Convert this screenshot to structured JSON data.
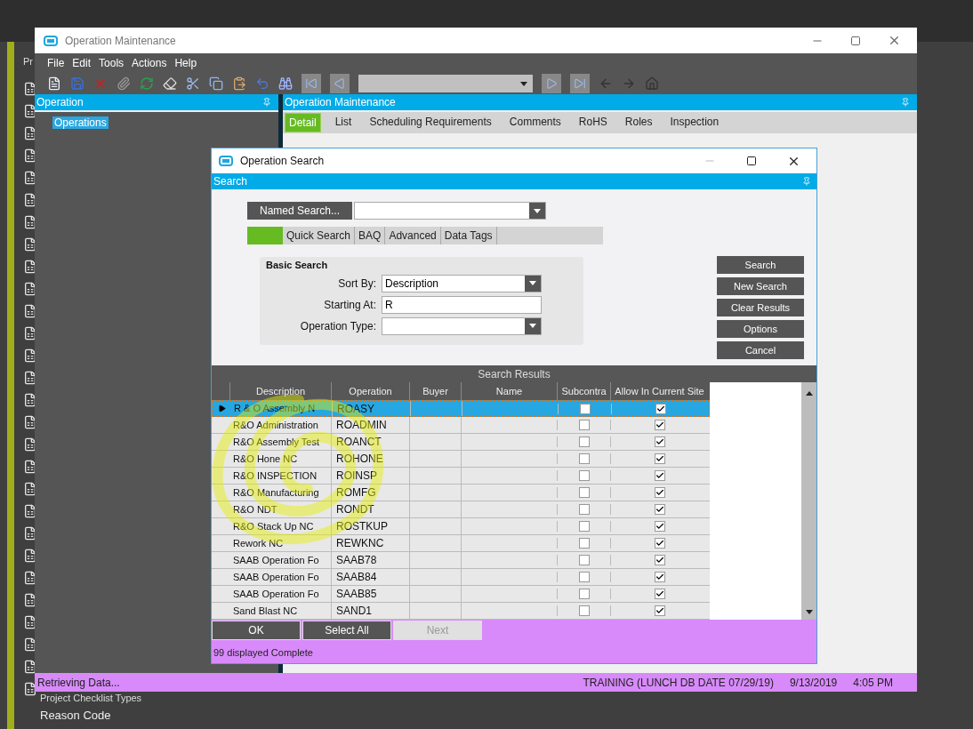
{
  "background": {
    "top_item": "Pr",
    "items": [
      "Project Checklist Types",
      "Reason Code"
    ]
  },
  "window": {
    "title": "Operation Maintenance",
    "menu": [
      "File",
      "Edit",
      "Tools",
      "Actions",
      "Help"
    ]
  },
  "left_pane": {
    "title": "Operation",
    "tree": [
      {
        "label": "Operations",
        "selected": true
      }
    ]
  },
  "right_pane": {
    "title": "Operation Maintenance",
    "tabs": [
      {
        "label": "Detail",
        "selected": true
      },
      {
        "label": "List",
        "selected": false
      },
      {
        "label": "Scheduling Requirements",
        "selected": false
      },
      {
        "label": "Comments",
        "selected": false
      },
      {
        "label": "RoHS",
        "selected": false
      },
      {
        "label": "Roles",
        "selected": false
      },
      {
        "label": "Inspection",
        "selected": false
      }
    ]
  },
  "dialog": {
    "title": "Operation Search",
    "panel_title": "Search",
    "named_search_button": "Named Search...",
    "tabs": [
      {
        "selected": true
      },
      {
        "label": "Quick Search",
        "selected": false
      },
      {
        "label": "BAQ",
        "selected": false
      },
      {
        "label": "Advanced",
        "selected": false
      },
      {
        "label": "Data Tags",
        "selected": false
      }
    ],
    "group_title": "Basic Search",
    "fields": [
      {
        "label": "Sort By:",
        "value": "Description",
        "kind": "dropdown"
      },
      {
        "label": "Starting At:",
        "value": "R",
        "kind": "text"
      },
      {
        "label": "Operation Type:",
        "kind": "dropdown"
      }
    ],
    "side_buttons": [
      "Search",
      "New Search",
      "Clear Results",
      "Options",
      "Cancel"
    ],
    "results_title": "Search Results",
    "columns": [
      "Description",
      "Operation",
      "Buyer",
      "Name",
      "Subcontra",
      "Allow In Current Site"
    ],
    "rows": [
      {
        "description": "R & O Assembly N",
        "operation": "ROASY",
        "subcontract": false,
        "allow": true,
        "selected": true
      },
      {
        "description": "R&O Administration",
        "operation": "ROADMIN",
        "subcontract": false,
        "allow": true,
        "selected": false
      },
      {
        "description": "R&O Assembly Test",
        "operation": "ROANCT",
        "subcontract": false,
        "allow": true,
        "selected": false
      },
      {
        "description": "R&O Hone NC",
        "operation": "ROHONE",
        "subcontract": false,
        "allow": true,
        "selected": false
      },
      {
        "description": "R&O INSPECTION",
        "operation": "ROINSP",
        "subcontract": false,
        "allow": true,
        "selected": false
      },
      {
        "description": "R&O Manufacturing",
        "operation": "ROMFG",
        "subcontract": false,
        "allow": true,
        "selected": false
      },
      {
        "description": "R&O NDT",
        "operation": "RONDT",
        "subcontract": false,
        "allow": true,
        "selected": false
      },
      {
        "description": "R&O Stack Up NC",
        "operation": "ROSTKUP",
        "subcontract": false,
        "allow": true,
        "selected": false
      },
      {
        "description": "Rework NC",
        "operation": "REWKNC",
        "subcontract": false,
        "allow": true,
        "selected": false
      },
      {
        "description": "SAAB Operation Fo",
        "operation": "SAAB78",
        "subcontract": false,
        "allow": true,
        "selected": false
      },
      {
        "description": "SAAB Operation Fo",
        "operation": "SAAB84",
        "subcontract": false,
        "allow": true,
        "selected": false
      },
      {
        "description": "SAAB Operation Fo",
        "operation": "SAAB85",
        "subcontract": false,
        "allow": true,
        "selected": false
      },
      {
        "description": "Sand Blast NC",
        "operation": "SAND1",
        "subcontract": false,
        "allow": true,
        "selected": false
      }
    ],
    "bottom_buttons": [
      {
        "label": "OK",
        "disabled": false
      },
      {
        "label": "Select All",
        "disabled": false
      },
      {
        "label": "Next",
        "disabled": true
      }
    ],
    "status": "99 displayed Complete"
  },
  "status_bar": {
    "message": "Retrieving Data...",
    "environment": "TRAINING (LUNCH DB DATE 07/29/19)",
    "date": "9/13/2019",
    "time": "4:05 PM"
  }
}
